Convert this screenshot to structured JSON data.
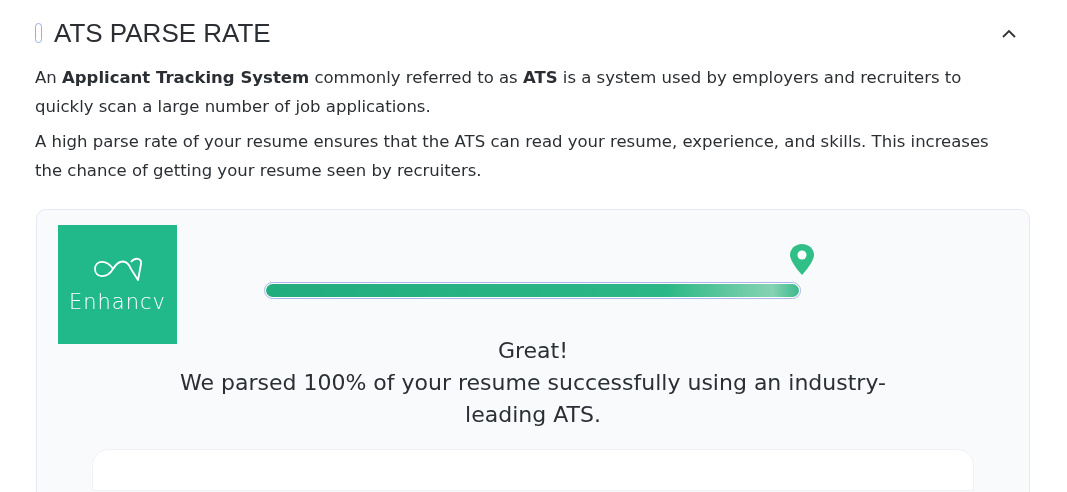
{
  "section": {
    "title": "ATS PARSE RATE",
    "expanded": true
  },
  "paragraphs": [
    "An **Applicant Tracking System** commonly referred to as **ATS** is a system used by employers and recruiters to quickly scan a large number of job applications.",
    "A high parse rate of your resume ensures that the ATS can read your resume, experience, and skills. This increases the chance of getting your resume seen by recruiters."
  ],
  "result": {
    "logo_text": "Enhancv",
    "parse": {
      "level": 1.0
    },
    "headline": "Great!",
    "message": "We parsed 100% of your resume successfully using an industry-leading ATS."
  }
}
